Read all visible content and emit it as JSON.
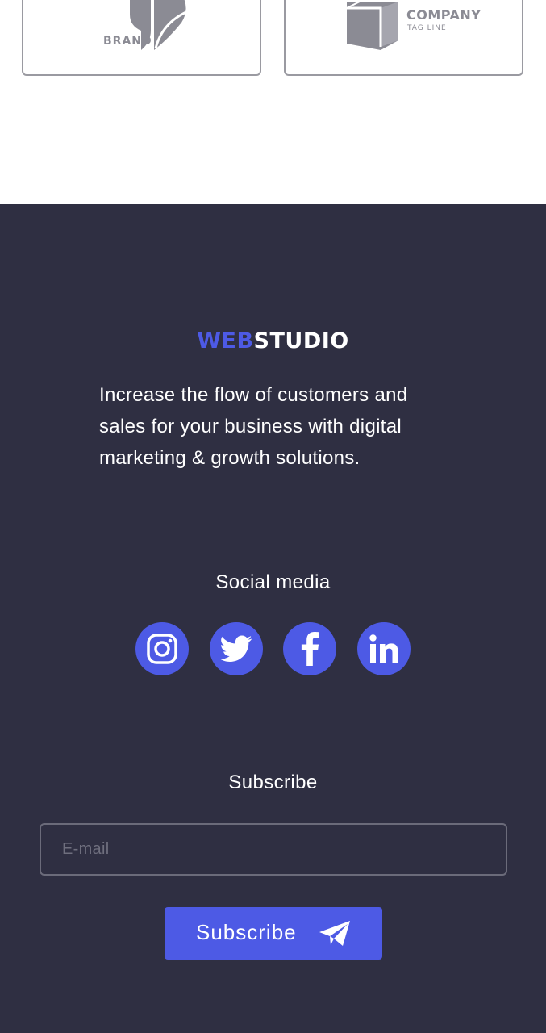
{
  "logos": {
    "brand_label": "BRAND",
    "company_label": "COMPANY",
    "company_tagline": "TAG LINE"
  },
  "footer": {
    "logo_accent": "WEB",
    "logo_rest": "STUDIO",
    "tagline": "Increase the flow of customers and sales for your business with digital marketing & growth solutions.",
    "social": {
      "title": "Social media",
      "icons": [
        "instagram-icon",
        "twitter-icon",
        "facebook-icon",
        "linkedin-icon"
      ]
    },
    "subscribe": {
      "title": "Subscribe",
      "email_placeholder": "E-mail",
      "email_value": "",
      "button_label": "Subscribe",
      "button_icon": "send-icon"
    }
  },
  "colors": {
    "accent": "#4d5ae5",
    "footer_bg": "#2f2f42",
    "logo_gray": "#8b8b94"
  }
}
